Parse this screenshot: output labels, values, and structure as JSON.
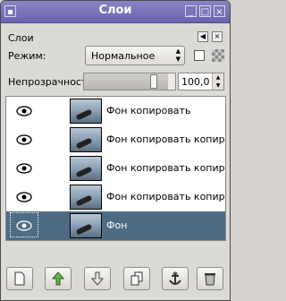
{
  "window": {
    "title": "Слои"
  },
  "panel": {
    "title": "Слои"
  },
  "mode": {
    "label": "Режим:",
    "value": "Нормальное"
  },
  "opacity": {
    "label": "Непрозрачность:",
    "value": "100,0",
    "fraction": 1.0
  },
  "layers": [
    {
      "name": "Фон копировать",
      "visible": true,
      "selected": false
    },
    {
      "name": "Фон копировать копировать",
      "visible": true,
      "selected": false
    },
    {
      "name": "Фон копировать копировать",
      "visible": true,
      "selected": false
    },
    {
      "name": "Фон копировать копировать",
      "visible": true,
      "selected": false
    },
    {
      "name": "Фон",
      "visible": true,
      "selected": true
    }
  ],
  "toolbar": {
    "buttons": [
      "new-layer",
      "raise-layer",
      "lower-layer",
      "duplicate-layer",
      "anchor-layer",
      "delete-layer"
    ]
  },
  "colors": {
    "titlebar": "#6a64ae",
    "selection": "#4e6c84"
  }
}
